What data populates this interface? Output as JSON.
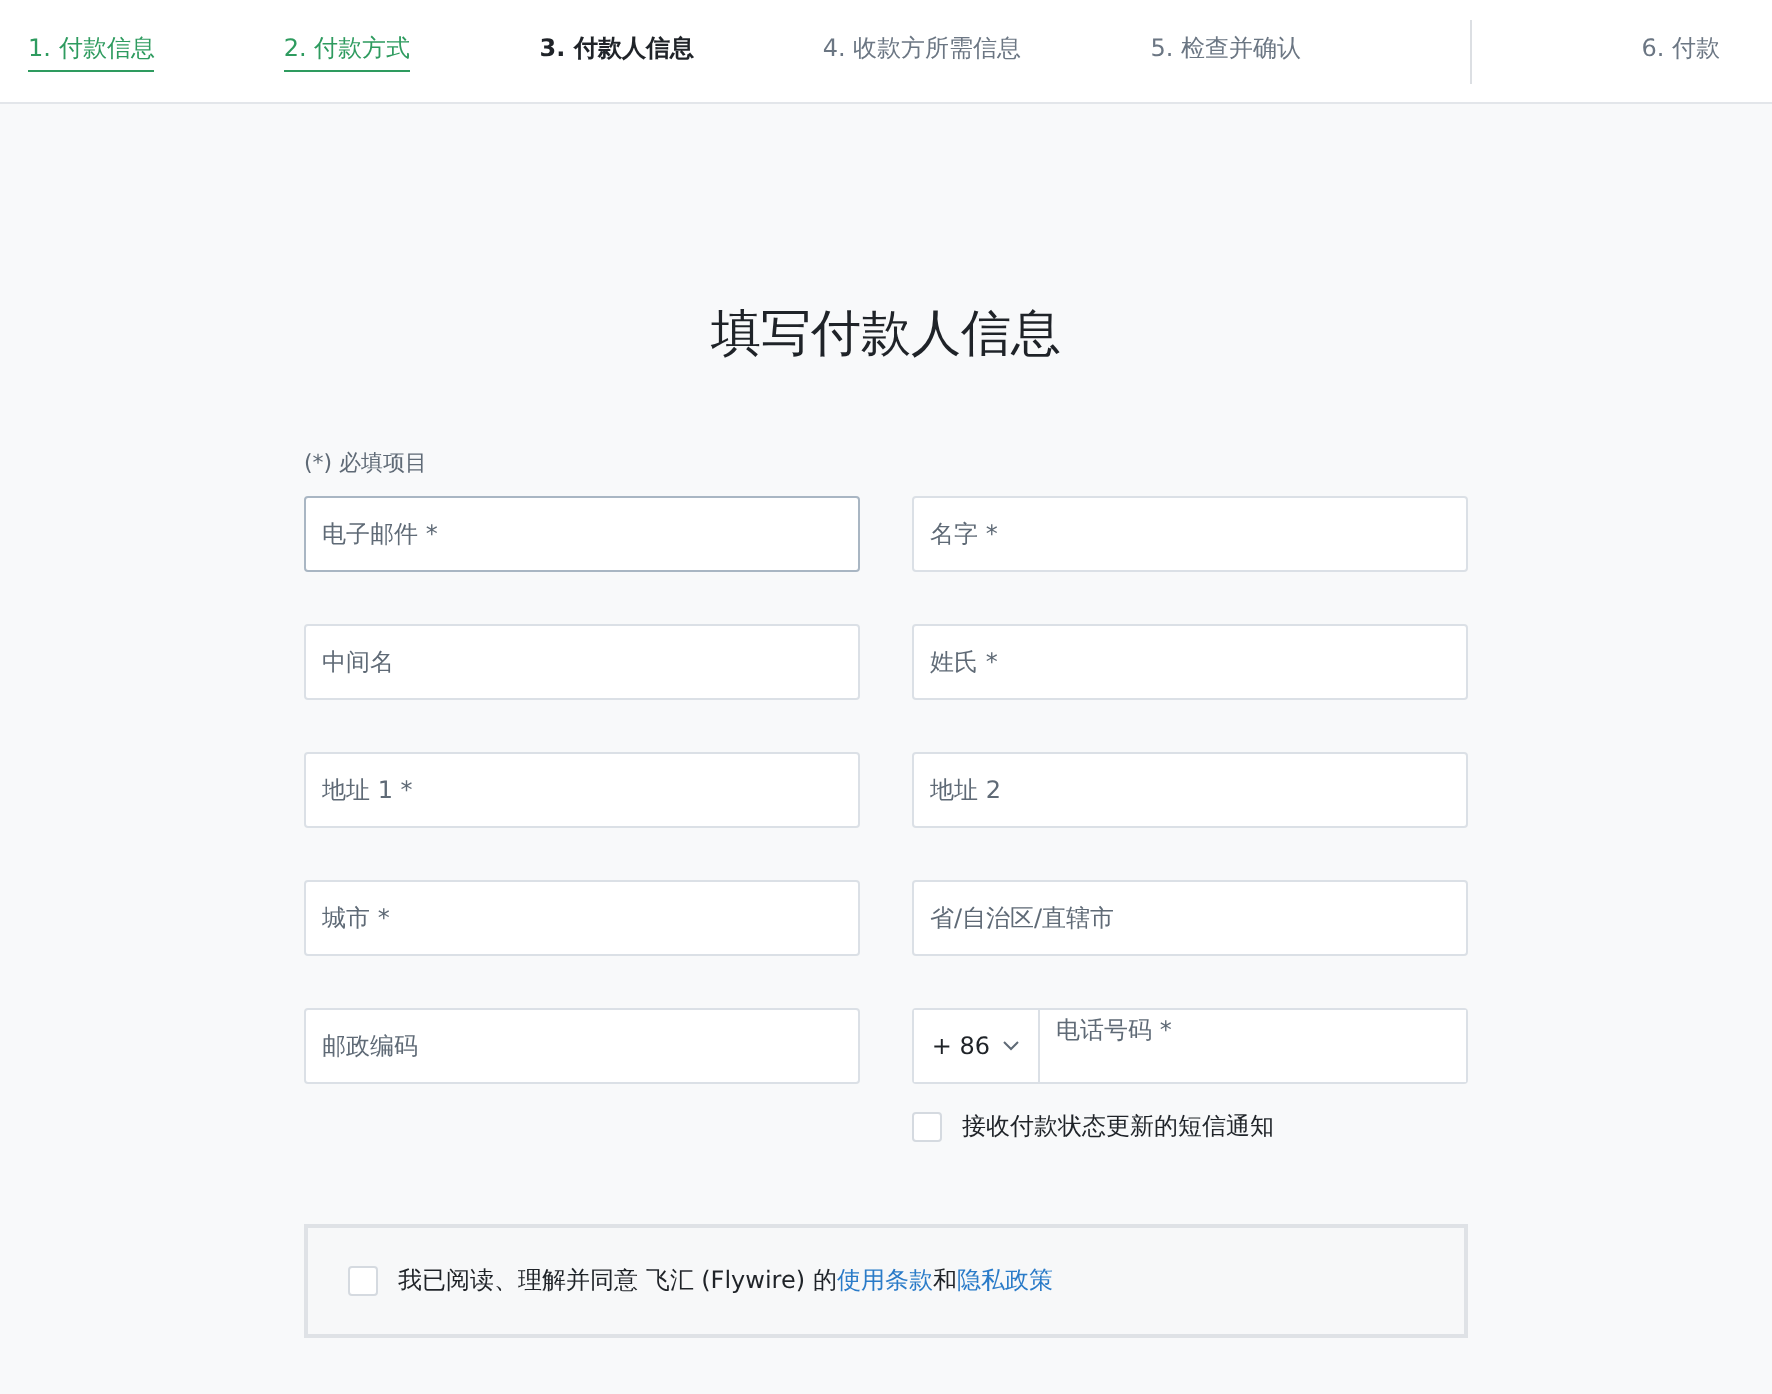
{
  "steps": [
    {
      "label": "1. 付款信息",
      "done": true,
      "selected": false
    },
    {
      "label": "2. 付款方式",
      "done": true,
      "selected": false
    },
    {
      "label": "3. 付款人信息",
      "done": false,
      "selected": true
    },
    {
      "label": "4. 收款方所需信息",
      "done": false,
      "selected": false
    },
    {
      "label": "5. 检查并确认",
      "done": false,
      "selected": false
    },
    {
      "label": "6. 付款",
      "done": false,
      "selected": false
    }
  ],
  "title": "填写付款人信息",
  "required_note": "(*) 必填项目",
  "field_rows": [
    [
      {
        "kind": "text",
        "placeholder": "电子邮件 *",
        "focused": true
      },
      {
        "kind": "text",
        "placeholder": "名字 *",
        "focused": false
      }
    ],
    [
      {
        "kind": "text",
        "placeholder": "中间名",
        "focused": false
      },
      {
        "kind": "text",
        "placeholder": "姓氏 *",
        "focused": false
      }
    ],
    [
      {
        "kind": "text",
        "placeholder": "地址 1 *",
        "focused": false
      },
      {
        "kind": "text",
        "placeholder": "地址 2",
        "focused": false
      }
    ],
    [
      {
        "kind": "text",
        "placeholder": "城市 *",
        "focused": false
      },
      {
        "kind": "text",
        "placeholder": "省/自治区/直辖市",
        "focused": false
      }
    ],
    [
      {
        "kind": "text",
        "placeholder": "邮政编码",
        "focused": false
      },
      {
        "kind": "phone",
        "country_code": "+ 86",
        "placeholder": "电话号码 *",
        "focused": false
      }
    ]
  ],
  "sms_option": {
    "label": "接收付款状态更新的短信通知",
    "checked": false
  },
  "terms": {
    "checked": false,
    "text": "我已阅读、理解并同意 飞汇 (Flywire) 的",
    "link_1": "使用条款",
    "joiner": "和",
    "link_2": "隐私政策"
  }
}
